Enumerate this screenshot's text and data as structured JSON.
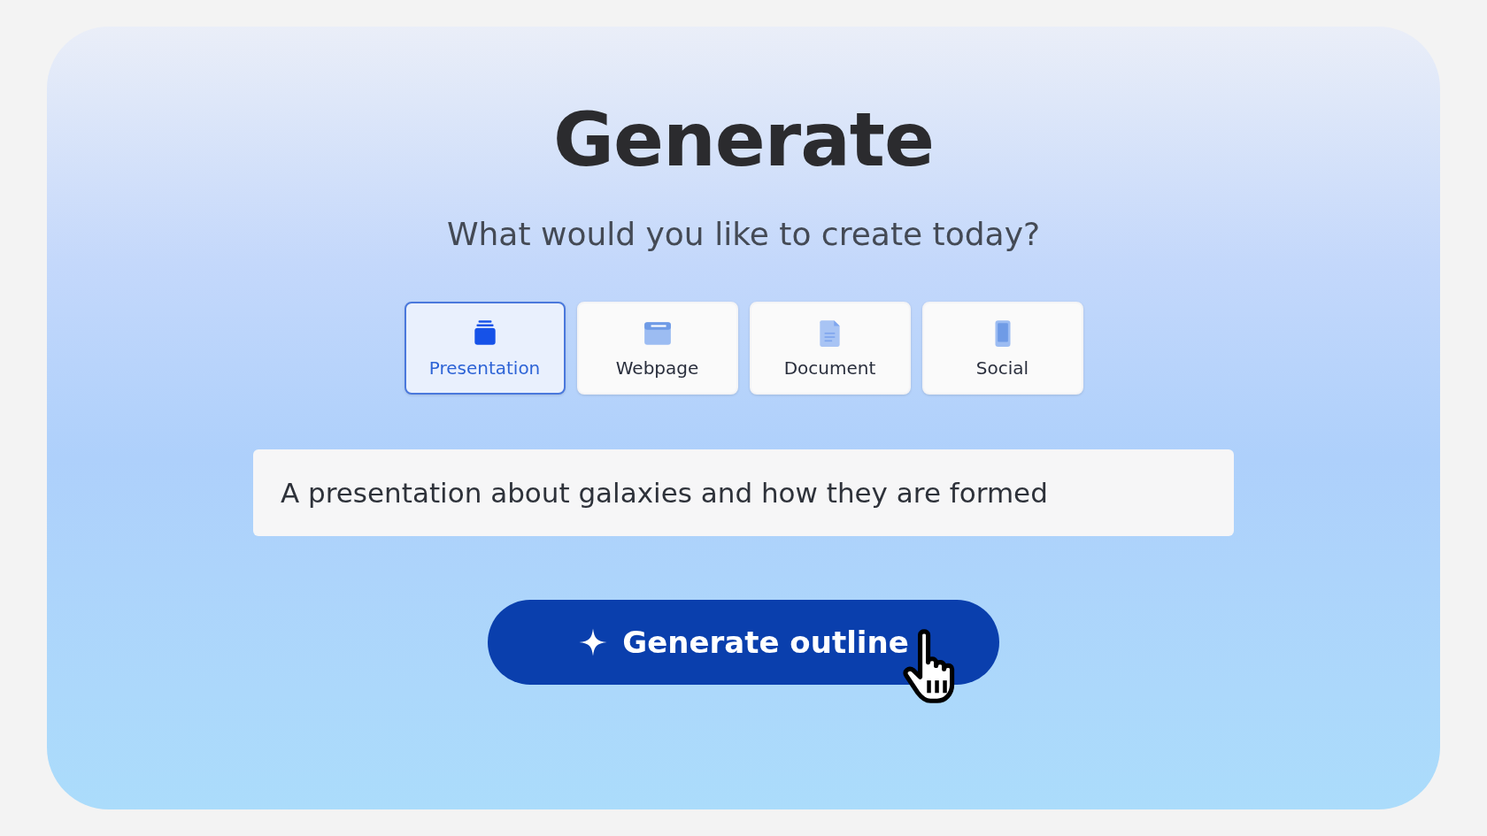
{
  "title": "Generate",
  "subtitle": "What would you like to create today?",
  "tabs": [
    {
      "label": "Presentation",
      "kind": "stack",
      "selected": true
    },
    {
      "label": "Webpage",
      "kind": "browser",
      "selected": false
    },
    {
      "label": "Document",
      "kind": "file",
      "selected": false
    },
    {
      "label": "Social",
      "kind": "phone",
      "selected": false
    }
  ],
  "prompt": {
    "value": "A presentation about galaxies and how they are formed"
  },
  "button": {
    "label": "Generate outline"
  }
}
